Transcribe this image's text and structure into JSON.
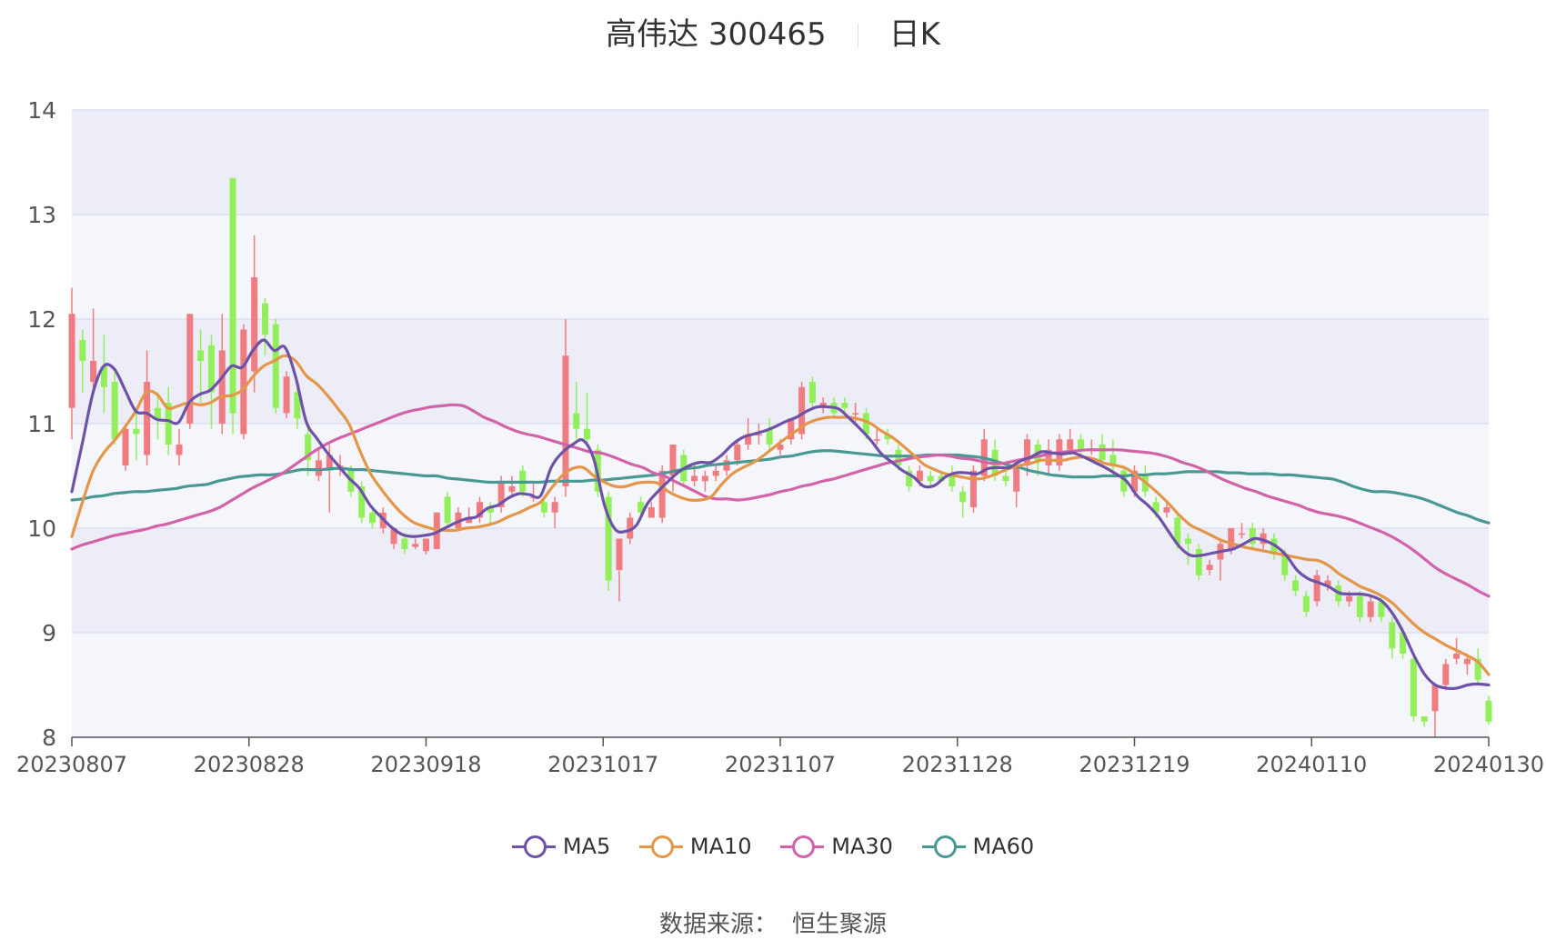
{
  "title": {
    "name": "高伟达 300465",
    "period": "日K"
  },
  "source": {
    "label": "数据来源：",
    "value": "恒生聚源"
  },
  "colors": {
    "up": "#f07c82",
    "down": "#91f05a",
    "MA5": "#6e52a8",
    "MA10": "#e4964a",
    "MA30": "#d263a8",
    "MA60": "#4a9894"
  },
  "chart_data": {
    "type": "candlestick",
    "ylim": [
      8,
      14
    ],
    "yticks": [
      8,
      9,
      10,
      11,
      12,
      13,
      14
    ],
    "xticks": [
      "20230807",
      "20230828",
      "20230918",
      "20231017",
      "20231107",
      "20231128",
      "20231219",
      "20240110",
      "20240130"
    ],
    "grid": true,
    "legend_position": "bottom",
    "legend": [
      "MA5",
      "MA10",
      "MA30",
      "MA60"
    ],
    "candles": [
      [
        11.15,
        12.05,
        12.3,
        10.85
      ],
      [
        11.8,
        11.6,
        11.9,
        11.3
      ],
      [
        11.4,
        11.6,
        12.1,
        11.3
      ],
      [
        11.55,
        11.35,
        11.85,
        11.1
      ],
      [
        11.4,
        10.85,
        11.5,
        10.8
      ],
      [
        10.6,
        10.95,
        11.0,
        10.55
      ],
      [
        10.95,
        10.9,
        11.1,
        10.65
      ],
      [
        10.7,
        11.4,
        11.7,
        10.6
      ],
      [
        11.15,
        11.05,
        11.3,
        10.85
      ],
      [
        11.2,
        10.8,
        11.35,
        10.7
      ],
      [
        10.7,
        10.8,
        10.95,
        10.6
      ],
      [
        11.0,
        12.05,
        12.05,
        10.95
      ],
      [
        11.7,
        11.6,
        11.9,
        11.2
      ],
      [
        11.75,
        11.3,
        11.85,
        10.95
      ],
      [
        11.0,
        11.7,
        12.05,
        10.9
      ],
      [
        13.35,
        11.1,
        13.35,
        10.9
      ],
      [
        10.9,
        11.9,
        11.95,
        10.85
      ],
      [
        11.5,
        12.4,
        12.8,
        11.3
      ],
      [
        12.15,
        11.85,
        12.2,
        11.65
      ],
      [
        11.95,
        11.15,
        12.0,
        11.1
      ],
      [
        11.1,
        11.45,
        11.5,
        11.05
      ],
      [
        11.3,
        11.05,
        11.4,
        10.95
      ],
      [
        10.9,
        10.65,
        10.95,
        10.5
      ],
      [
        10.5,
        10.65,
        10.75,
        10.45
      ],
      [
        10.55,
        10.7,
        10.8,
        10.15
      ],
      [
        10.6,
        10.6,
        10.7,
        10.5
      ],
      [
        10.55,
        10.35,
        10.6,
        10.3
      ],
      [
        10.4,
        10.1,
        10.45,
        10.05
      ],
      [
        10.15,
        10.05,
        10.2,
        10.0
      ],
      [
        10.0,
        10.15,
        10.2,
        9.95
      ],
      [
        9.85,
        10.0,
        10.0,
        9.8
      ],
      [
        9.9,
        9.8,
        9.95,
        9.75
      ],
      [
        9.82,
        9.85,
        9.9,
        9.8
      ],
      [
        9.78,
        9.9,
        9.9,
        9.75
      ],
      [
        9.8,
        10.15,
        10.15,
        9.8
      ],
      [
        10.3,
        10.05,
        10.35,
        10.0
      ],
      [
        10.0,
        10.15,
        10.2,
        9.98
      ],
      [
        10.05,
        10.1,
        10.2,
        10.05
      ],
      [
        10.1,
        10.25,
        10.3,
        10.05
      ],
      [
        10.2,
        10.15,
        10.25,
        10.05
      ],
      [
        10.2,
        10.45,
        10.5,
        10.15
      ],
      [
        10.35,
        10.4,
        10.5,
        10.3
      ],
      [
        10.55,
        10.35,
        10.6,
        10.3
      ],
      [
        10.3,
        10.3,
        10.45,
        10.25
      ],
      [
        10.25,
        10.15,
        10.3,
        10.1
      ],
      [
        10.15,
        10.25,
        10.3,
        10.0
      ],
      [
        10.4,
        11.65,
        12.0,
        10.3
      ],
      [
        11.1,
        10.95,
        11.4,
        10.85
      ],
      [
        10.95,
        10.85,
        11.3,
        10.8
      ],
      [
        10.75,
        10.35,
        10.8,
        10.3
      ],
      [
        10.3,
        9.5,
        10.35,
        9.4
      ],
      [
        9.6,
        9.9,
        9.9,
        9.3
      ],
      [
        9.9,
        10.1,
        10.15,
        9.85
      ],
      [
        10.25,
        10.15,
        10.3,
        10.1
      ],
      [
        10.1,
        10.2,
        10.25,
        10.1
      ],
      [
        10.1,
        10.55,
        10.6,
        10.05
      ],
      [
        10.5,
        10.8,
        10.8,
        10.35
      ],
      [
        10.7,
        10.45,
        10.75,
        10.4
      ],
      [
        10.45,
        10.5,
        10.6,
        10.4
      ],
      [
        10.45,
        10.5,
        10.55,
        10.35
      ],
      [
        10.5,
        10.55,
        10.6,
        10.45
      ],
      [
        10.55,
        10.65,
        10.7,
        10.5
      ],
      [
        10.65,
        10.8,
        10.85,
        10.6
      ],
      [
        10.8,
        10.9,
        11.05,
        10.75
      ],
      [
        10.9,
        10.9,
        11.0,
        10.8
      ],
      [
        10.95,
        10.8,
        11.05,
        10.75
      ],
      [
        10.75,
        10.8,
        10.85,
        10.7
      ],
      [
        10.85,
        11.05,
        11.05,
        10.8
      ],
      [
        10.9,
        11.35,
        11.4,
        10.85
      ],
      [
        11.4,
        11.2,
        11.45,
        11.15
      ],
      [
        11.15,
        11.2,
        11.25,
        11.1
      ],
      [
        11.2,
        11.1,
        11.25,
        11.05
      ],
      [
        11.2,
        11.15,
        11.25,
        11.1
      ],
      [
        11.1,
        11.1,
        11.2,
        11.0
      ],
      [
        11.1,
        10.9,
        11.15,
        10.85
      ],
      [
        10.85,
        10.85,
        10.95,
        10.8
      ],
      [
        10.9,
        10.85,
        10.95,
        10.8
      ],
      [
        10.75,
        10.6,
        10.8,
        10.55
      ],
      [
        10.55,
        10.4,
        10.6,
        10.35
      ],
      [
        10.45,
        10.55,
        10.6,
        10.4
      ],
      [
        10.5,
        10.45,
        10.55,
        10.4
      ],
      [
        10.5,
        10.45,
        10.55,
        10.45
      ],
      [
        10.5,
        10.4,
        10.6,
        10.35
      ],
      [
        10.35,
        10.25,
        10.4,
        10.1
      ],
      [
        10.2,
        10.55,
        10.6,
        10.15
      ],
      [
        10.5,
        10.85,
        10.95,
        10.45
      ],
      [
        10.75,
        10.5,
        10.85,
        10.45
      ],
      [
        10.5,
        10.45,
        10.55,
        10.4
      ],
      [
        10.35,
        10.6,
        10.65,
        10.2
      ],
      [
        10.6,
        10.85,
        10.9,
        10.5
      ],
      [
        10.8,
        10.65,
        10.85,
        10.5
      ],
      [
        10.6,
        10.75,
        10.85,
        10.5
      ],
      [
        10.6,
        10.85,
        10.9,
        10.55
      ],
      [
        10.75,
        10.85,
        10.95,
        10.7
      ],
      [
        10.85,
        10.75,
        10.9,
        10.7
      ],
      [
        10.75,
        10.75,
        10.85,
        10.7
      ],
      [
        10.8,
        10.65,
        10.9,
        10.6
      ],
      [
        10.7,
        10.6,
        10.85,
        10.5
      ],
      [
        10.55,
        10.35,
        10.6,
        10.3
      ],
      [
        10.35,
        10.55,
        10.6,
        10.3
      ],
      [
        10.5,
        10.35,
        10.6,
        10.3
      ],
      [
        10.25,
        10.15,
        10.3,
        10.1
      ],
      [
        10.15,
        10.2,
        10.25,
        10.1
      ],
      [
        10.1,
        9.85,
        10.15,
        9.8
      ],
      [
        9.9,
        9.85,
        9.95,
        9.65
      ],
      [
        9.8,
        9.55,
        9.85,
        9.5
      ],
      [
        9.6,
        9.65,
        9.7,
        9.55
      ],
      [
        9.7,
        9.85,
        9.9,
        9.5
      ],
      [
        9.8,
        10.0,
        10.0,
        9.75
      ],
      [
        9.95,
        9.95,
        10.05,
        9.9
      ],
      [
        10.0,
        9.85,
        10.05,
        9.8
      ],
      [
        9.85,
        9.95,
        10.0,
        9.8
      ],
      [
        9.9,
        9.75,
        9.95,
        9.7
      ],
      [
        9.75,
        9.55,
        9.8,
        9.5
      ],
      [
        9.5,
        9.4,
        9.55,
        9.35
      ],
      [
        9.35,
        9.2,
        9.4,
        9.15
      ],
      [
        9.3,
        9.55,
        9.6,
        9.25
      ],
      [
        9.45,
        9.5,
        9.55,
        9.4
      ],
      [
        9.45,
        9.3,
        9.5,
        9.25
      ],
      [
        9.3,
        9.35,
        9.4,
        9.25
      ],
      [
        9.35,
        9.15,
        9.4,
        9.1
      ],
      [
        9.15,
        9.3,
        9.35,
        9.1
      ],
      [
        9.3,
        9.15,
        9.35,
        9.1
      ],
      [
        9.1,
        8.85,
        9.15,
        8.75
      ],
      [
        9.0,
        8.8,
        9.05,
        8.75
      ],
      [
        8.75,
        8.2,
        8.8,
        8.15
      ],
      [
        8.2,
        8.15,
        8.2,
        8.1
      ],
      [
        8.25,
        8.5,
        8.5,
        8.0
      ],
      [
        8.5,
        8.7,
        8.75,
        8.45
      ],
      [
        8.75,
        8.8,
        8.95,
        8.7
      ],
      [
        8.7,
        8.75,
        8.8,
        8.6
      ],
      [
        8.75,
        8.55,
        8.85,
        8.5
      ],
      [
        8.35,
        8.15,
        8.4,
        8.12
      ]
    ],
    "series": [
      {
        "name": "MA5",
        "values": [
          10.35,
          10.82,
          11.3,
          11.55,
          11.52,
          11.32,
          11.12,
          11.1,
          11.04,
          11.03,
          11.01,
          11.2,
          11.28,
          11.32,
          11.43,
          11.55,
          11.54,
          11.7,
          11.8,
          11.7,
          11.73,
          11.45,
          11.02,
          10.86,
          10.72,
          10.6,
          10.48,
          10.38,
          10.22,
          10.11,
          10.01,
          9.94,
          9.92,
          9.93,
          9.95,
          10.0,
          10.05,
          10.09,
          10.11,
          10.19,
          10.22,
          10.29,
          10.33,
          10.32,
          10.31,
          10.58,
          10.72,
          10.8,
          10.84,
          10.66,
          10.22,
          9.99,
          9.97,
          10.03,
          10.23,
          10.35,
          10.45,
          10.54,
          10.6,
          10.63,
          10.63,
          10.7,
          10.8,
          10.87,
          10.9,
          10.93,
          10.97,
          11.02,
          11.06,
          11.12,
          11.16,
          11.16,
          11.14,
          11.05,
          10.95,
          10.84,
          10.71,
          10.63,
          10.55,
          10.49,
          10.4,
          10.41,
          10.49,
          10.53,
          10.53,
          10.52,
          10.57,
          10.58,
          10.58,
          10.64,
          10.68,
          10.73,
          10.72,
          10.71,
          10.72,
          10.68,
          10.63,
          10.58,
          10.52,
          10.45,
          10.31,
          10.22,
          10.11,
          9.96,
          9.82,
          9.74,
          9.74,
          9.76,
          9.78,
          9.8,
          9.85,
          9.9,
          9.88,
          9.83,
          9.74,
          9.6,
          9.52,
          9.48,
          9.44,
          9.38,
          9.37,
          9.37,
          9.35,
          9.3,
          9.18,
          9.0,
          8.78,
          8.6,
          8.5,
          8.47,
          8.47,
          8.5,
          8.51,
          8.5
        ]
      },
      {
        "name": "MA10",
        "values": [
          9.92,
          10.25,
          10.55,
          10.72,
          10.84,
          10.97,
          11.12,
          11.3,
          11.28,
          11.15,
          11.17,
          11.2,
          11.18,
          11.2,
          11.26,
          11.27,
          11.32,
          11.45,
          11.55,
          11.6,
          11.65,
          11.6,
          11.46,
          11.38,
          11.27,
          11.14,
          11.0,
          10.75,
          10.53,
          10.38,
          10.25,
          10.14,
          10.06,
          10.02,
          9.99,
          9.98,
          9.98,
          10.0,
          10.01,
          10.03,
          10.06,
          10.11,
          10.15,
          10.2,
          10.25,
          10.38,
          10.5,
          10.57,
          10.58,
          10.5,
          10.44,
          10.4,
          10.4,
          10.43,
          10.44,
          10.43,
          10.35,
          10.3,
          10.27,
          10.27,
          10.3,
          10.42,
          10.52,
          10.58,
          10.63,
          10.7,
          10.78,
          10.86,
          10.93,
          11.0,
          11.04,
          11.06,
          11.06,
          11.06,
          11.04,
          11.0,
          10.93,
          10.87,
          10.79,
          10.7,
          10.61,
          10.56,
          10.52,
          10.5,
          10.48,
          10.47,
          10.49,
          10.53,
          10.57,
          10.6,
          10.62,
          10.65,
          10.65,
          10.65,
          10.67,
          10.68,
          10.66,
          10.62,
          10.6,
          10.57,
          10.5,
          10.42,
          10.33,
          10.23,
          10.12,
          10.03,
          9.98,
          9.93,
          9.88,
          9.85,
          9.82,
          9.8,
          9.78,
          9.76,
          9.74,
          9.72,
          9.7,
          9.69,
          9.64,
          9.56,
          9.5,
          9.44,
          9.4,
          9.35,
          9.28,
          9.18,
          9.08,
          9.0,
          8.94,
          8.88,
          8.83,
          8.78,
          8.72,
          8.6
        ]
      },
      {
        "name": "MA30",
        "values": [
          9.8,
          9.84,
          9.87,
          9.9,
          9.93,
          9.95,
          9.97,
          9.99,
          10.02,
          10.04,
          10.07,
          10.1,
          10.13,
          10.16,
          10.2,
          10.26,
          10.32,
          10.38,
          10.43,
          10.48,
          10.53,
          10.6,
          10.67,
          10.74,
          10.8,
          10.85,
          10.89,
          10.93,
          10.97,
          11.01,
          11.05,
          11.09,
          11.12,
          11.14,
          11.16,
          11.17,
          11.18,
          11.17,
          11.12,
          11.06,
          11.02,
          10.97,
          10.93,
          10.9,
          10.88,
          10.85,
          10.82,
          10.79,
          10.76,
          10.73,
          10.72,
          10.69,
          10.65,
          10.61,
          10.58,
          10.53,
          10.5,
          10.45,
          10.4,
          10.35,
          10.3,
          10.28,
          10.28,
          10.27,
          10.28,
          10.3,
          10.32,
          10.35,
          10.37,
          10.4,
          10.42,
          10.45,
          10.47,
          10.5,
          10.53,
          10.56,
          10.59,
          10.62,
          10.64,
          10.66,
          10.68,
          10.69,
          10.7,
          10.69,
          10.67,
          10.66,
          10.64,
          10.62,
          10.62,
          10.64,
          10.66,
          10.68,
          10.7,
          10.72,
          10.73,
          10.74,
          10.75,
          10.75,
          10.75,
          10.75,
          10.74,
          10.73,
          10.72,
          10.7,
          10.67,
          10.63,
          10.6,
          10.56,
          10.51,
          10.46,
          10.42,
          10.38,
          10.35,
          10.31,
          10.28,
          10.25,
          10.22,
          10.18,
          10.15,
          10.13,
          10.11,
          10.08,
          10.04,
          10.0,
          9.96,
          9.91,
          9.85,
          9.78,
          9.7,
          9.62,
          9.56,
          9.51,
          9.46,
          9.4,
          9.35
        ]
      },
      {
        "name": "MA60",
        "values": [
          10.27,
          10.28,
          10.3,
          10.31,
          10.33,
          10.34,
          10.35,
          10.35,
          10.36,
          10.37,
          10.38,
          10.4,
          10.41,
          10.42,
          10.45,
          10.47,
          10.49,
          10.5,
          10.51,
          10.51,
          10.52,
          10.54,
          10.56,
          10.56,
          10.56,
          10.57,
          10.57,
          10.56,
          10.56,
          10.55,
          10.54,
          10.53,
          10.52,
          10.51,
          10.5,
          10.5,
          10.48,
          10.47,
          10.46,
          10.45,
          10.44,
          10.44,
          10.44,
          10.44,
          10.44,
          10.44,
          10.45,
          10.45,
          10.45,
          10.45,
          10.46,
          10.46,
          10.47,
          10.48,
          10.49,
          10.5,
          10.51,
          10.53,
          10.55,
          10.57,
          10.58,
          10.6,
          10.61,
          10.62,
          10.63,
          10.64,
          10.65,
          10.66,
          10.68,
          10.69,
          10.71,
          10.73,
          10.74,
          10.74,
          10.73,
          10.72,
          10.71,
          10.7,
          10.69,
          10.69,
          10.69,
          10.69,
          10.7,
          10.7,
          10.7,
          10.7,
          10.69,
          10.68,
          10.66,
          10.63,
          10.6,
          10.58,
          10.55,
          10.53,
          10.51,
          10.5,
          10.49,
          10.49,
          10.49,
          10.5,
          10.5,
          10.5,
          10.51,
          10.51,
          10.52,
          10.52,
          10.53,
          10.54,
          10.54,
          10.54,
          10.54,
          10.53,
          10.53,
          10.52,
          10.52,
          10.52,
          10.51,
          10.51,
          10.5,
          10.49,
          10.48,
          10.47,
          10.44,
          10.4,
          10.37,
          10.35,
          10.35,
          10.34,
          10.32,
          10.3,
          10.27,
          10.23,
          10.19,
          10.15,
          10.12,
          10.08,
          10.05
        ]
      }
    ]
  }
}
